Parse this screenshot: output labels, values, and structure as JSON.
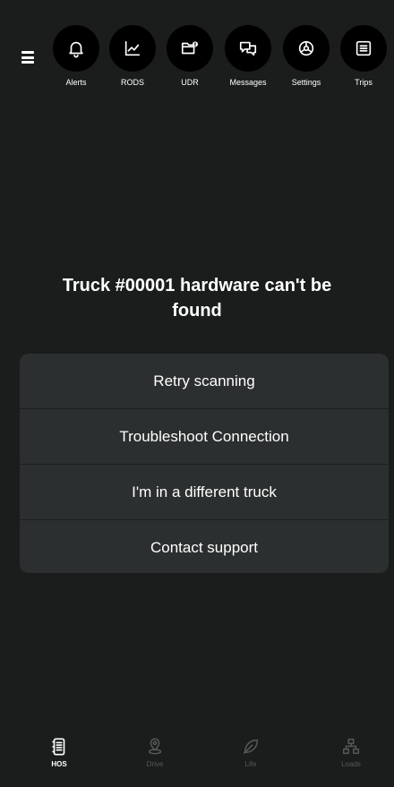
{
  "toolbar": {
    "items": [
      {
        "label": "Alerts",
        "icon": "bell-icon"
      },
      {
        "label": "RODS",
        "icon": "line-chart-icon"
      },
      {
        "label": "UDR",
        "icon": "folder-alert-icon"
      },
      {
        "label": "Messages",
        "icon": "chat-bubbles-icon"
      },
      {
        "label": "Settings",
        "icon": "gear-icon"
      },
      {
        "label": "Trips",
        "icon": "list-card-icon"
      }
    ]
  },
  "message": {
    "title": "Truck #00001 hardware can't be found"
  },
  "options": [
    {
      "label": "Retry scanning"
    },
    {
      "label": "Troubleshoot Connection"
    },
    {
      "label": "I'm in a different truck"
    },
    {
      "label": "Contact support"
    }
  ],
  "bottom_nav": {
    "items": [
      {
        "label": "HOS",
        "icon": "logbook-icon",
        "active": true
      },
      {
        "label": "Drive",
        "icon": "map-pin-icon",
        "active": false
      },
      {
        "label": "Life",
        "icon": "leaf-icon",
        "active": false
      },
      {
        "label": "Loads",
        "icon": "network-icon",
        "active": false
      }
    ]
  },
  "colors": {
    "background": "#1b1d1d",
    "card": "#2b2f2f",
    "icon_circle": "#000000",
    "inactive_nav": "#555a5a"
  }
}
